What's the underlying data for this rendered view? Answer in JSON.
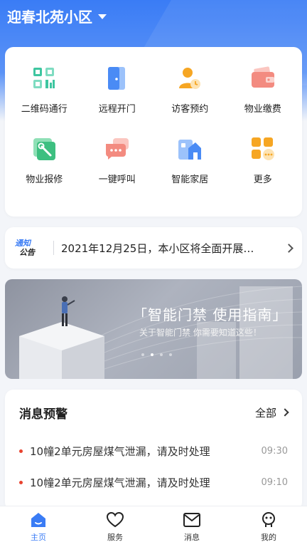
{
  "header": {
    "community_name": "迎春北苑小区"
  },
  "quick_actions": [
    {
      "label": "二维码通行",
      "icon": "qr-code-icon"
    },
    {
      "label": "远程开门",
      "icon": "door-icon"
    },
    {
      "label": "访客预约",
      "icon": "visitor-icon"
    },
    {
      "label": "物业缴费",
      "icon": "wallet-icon"
    },
    {
      "label": "物业报修",
      "icon": "wrench-icon"
    },
    {
      "label": "一键呼叫",
      "icon": "chat-icon"
    },
    {
      "label": "智能家居",
      "icon": "smart-home-icon"
    },
    {
      "label": "更多",
      "icon": "more-grid-icon"
    }
  ],
  "notice": {
    "badge_line1": "通知",
    "badge_line2": "公告",
    "text": "2021年12月25日，本小区将全面开展…"
  },
  "banner": {
    "title": "「智能门禁 使用指南」",
    "subtitle": "关于智能门禁 你需要知道这些！",
    "active_index": 1,
    "count": 4
  },
  "messages": {
    "title": "消息预警",
    "all_label": "全部",
    "items": [
      {
        "text": "10幢2单元房屋煤气泄漏，请及时处理",
        "time": "09:30"
      },
      {
        "text": "10幢2单元房屋煤气泄漏，请及时处理",
        "time": "09:10"
      }
    ]
  },
  "tabbar": [
    {
      "label": "主页",
      "icon": "home-icon",
      "active": true
    },
    {
      "label": "服务",
      "icon": "heart-icon",
      "active": false
    },
    {
      "label": "消息",
      "icon": "mail-icon",
      "active": false
    },
    {
      "label": "我的",
      "icon": "profile-icon",
      "active": false
    }
  ],
  "colors": {
    "accent": "#3a7cf5",
    "alert": "#e8432f"
  }
}
